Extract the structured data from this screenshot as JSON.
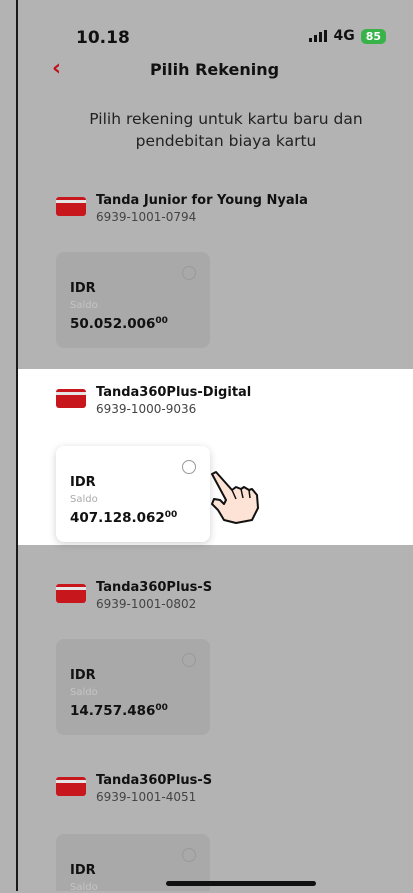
{
  "status": {
    "time": "10.18",
    "network": "4G",
    "battery": "85"
  },
  "header": {
    "back_icon": "chevron-left-icon",
    "title": "Pilih Rekening"
  },
  "subtitle": "Pilih rekening untuk kartu baru dan pendebitan biaya kartu",
  "accounts": [
    {
      "name": "Tanda Junior for Young Nyala",
      "number": "6939-1001-0794",
      "currency": "IDR",
      "label": "Saldo",
      "balance": "50.052.006",
      "decimals": "00"
    },
    {
      "name": "Tanda360Plus-Digital",
      "number": "6939-1000-9036",
      "currency": "IDR",
      "label": "Saldo",
      "balance": "407.128.062",
      "decimals": "00"
    },
    {
      "name": "Tanda360Plus-S",
      "number": "6939-1001-0802",
      "currency": "IDR",
      "label": "Saldo",
      "balance": "14.757.486",
      "decimals": "00"
    },
    {
      "name": "Tanda360Plus-S",
      "number": "6939-1001-4051",
      "currency": "IDR",
      "label": "Saldo"
    }
  ],
  "colors": {
    "accent": "#c0101a",
    "overlay": "#b3b3b3",
    "battery": "#37b34a"
  }
}
